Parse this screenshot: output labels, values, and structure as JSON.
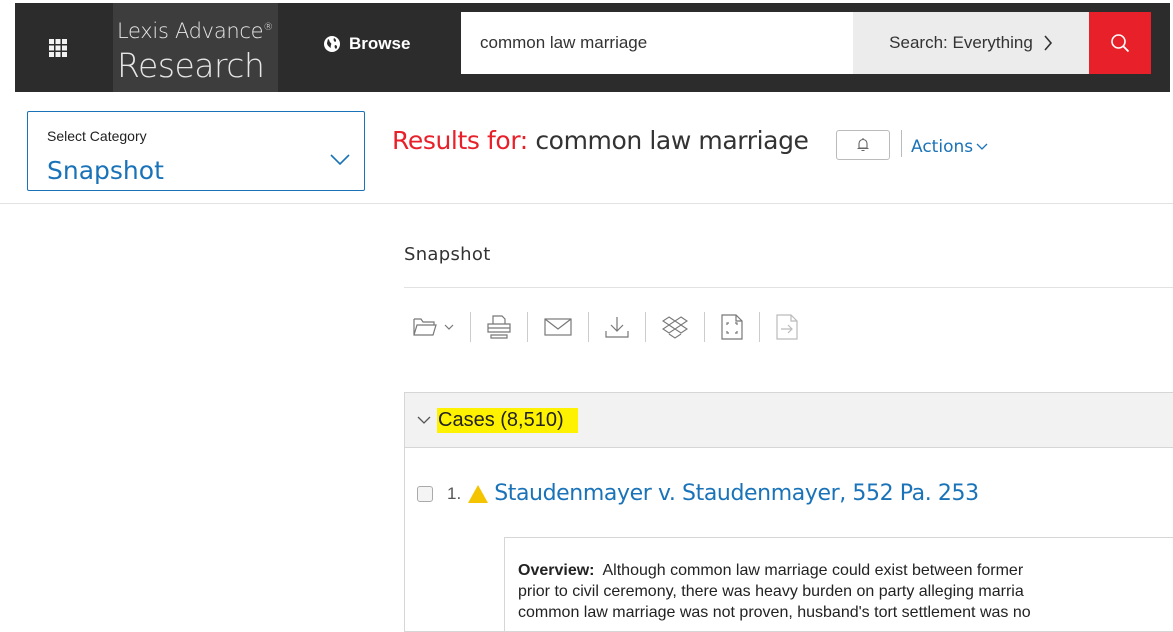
{
  "header": {
    "brand_top": "Lexis Advance",
    "brand_reg": "®",
    "brand_bottom": "Research",
    "browse_label": "Browse",
    "search_value": "common law marriage",
    "search_scope": "Search: Everything",
    "icons": [
      "apps-grid-icon",
      "globe-icon",
      "chevron-right-icon",
      "search-icon"
    ],
    "accent_color": "#e8202a"
  },
  "category": {
    "label": "Select Category",
    "value": "Snapshot"
  },
  "results": {
    "prefix": "Results for:",
    "query": "common law marriage",
    "actions_label": "Actions"
  },
  "snapshot": {
    "heading": "Snapshot",
    "toolbar_icons": [
      "folder-icon",
      "print-icon",
      "email-icon",
      "download-icon",
      "dropbox-icon",
      "full-screen-icon",
      "export-icon"
    ]
  },
  "cases": {
    "title": "Cases (8,510)",
    "results": [
      {
        "number": "1.",
        "title": "Staudenmayer v. Staudenmayer, 552 Pa. 253",
        "overview_label": "Overview:",
        "overview_lines": [
          "Although common law marriage could exist between former",
          "prior to civil ceremony, there was heavy burden on party alleging marria",
          "common law marriage was not proven, husband's tort settlement was no"
        ]
      }
    ]
  }
}
